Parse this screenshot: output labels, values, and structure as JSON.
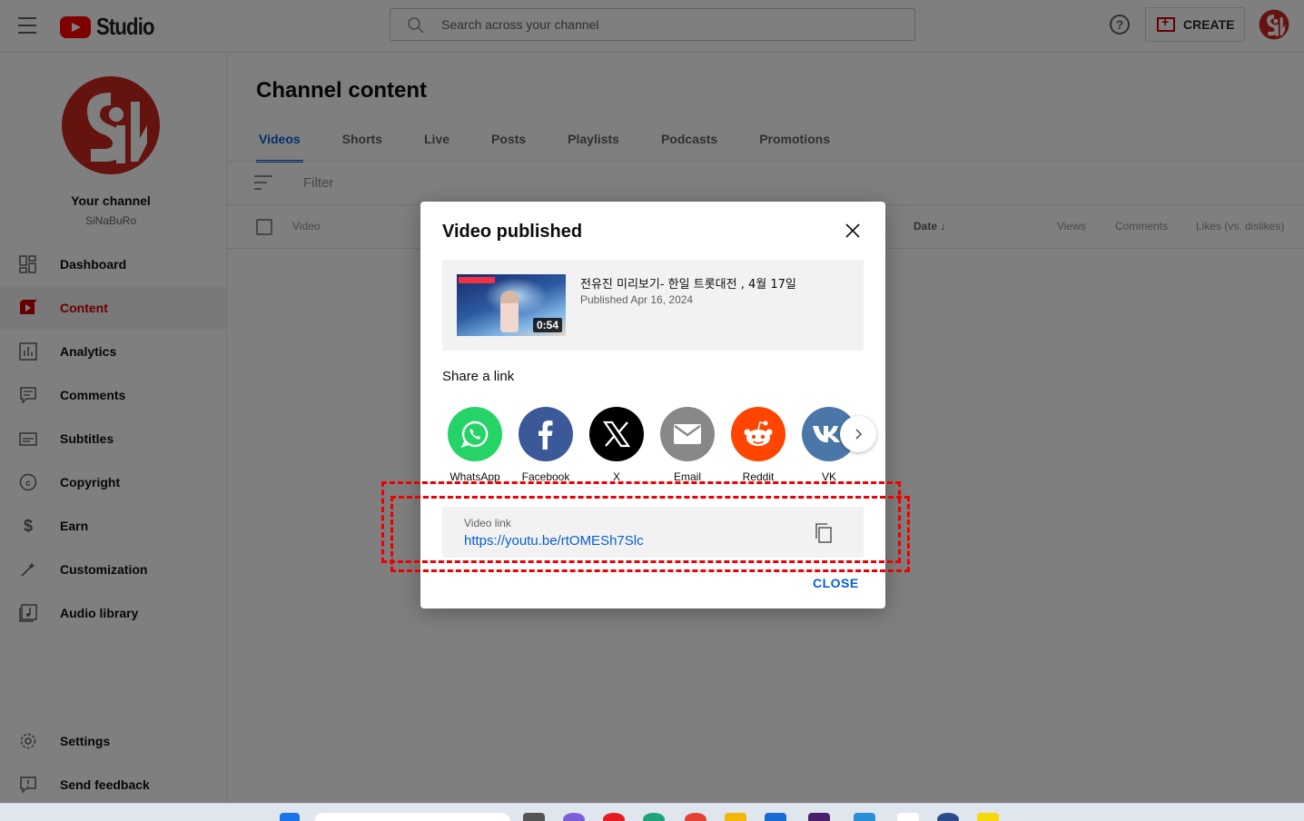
{
  "header": {
    "logo_text": "Studio",
    "search_placeholder": "Search across your channel",
    "help_symbol": "?",
    "create_label": "CREATE"
  },
  "channel": {
    "title": "Your channel",
    "handle": "SiNaBuRo"
  },
  "sidebar": {
    "items": [
      {
        "label": "Dashboard",
        "icon": "dashboard-icon"
      },
      {
        "label": "Content",
        "icon": "content-icon",
        "active": true
      },
      {
        "label": "Analytics",
        "icon": "analytics-icon"
      },
      {
        "label": "Comments",
        "icon": "comments-icon"
      },
      {
        "label": "Subtitles",
        "icon": "subtitles-icon"
      },
      {
        "label": "Copyright",
        "icon": "copyright-icon"
      },
      {
        "label": "Earn",
        "icon": "dollar-icon"
      },
      {
        "label": "Customization",
        "icon": "magic-wand-icon"
      },
      {
        "label": "Audio library",
        "icon": "audio-library-icon"
      }
    ],
    "bottom_items": [
      {
        "label": "Settings",
        "icon": "gear-icon"
      },
      {
        "label": "Send feedback",
        "icon": "feedback-icon"
      }
    ]
  },
  "main": {
    "title": "Channel content",
    "tabs": [
      {
        "label": "Videos",
        "active": true
      },
      {
        "label": "Shorts"
      },
      {
        "label": "Live"
      },
      {
        "label": "Posts"
      },
      {
        "label": "Playlists"
      },
      {
        "label": "Podcasts"
      },
      {
        "label": "Promotions"
      }
    ],
    "filter_placeholder": "Filter",
    "columns": {
      "video": "Video",
      "date": "Date",
      "views": "Views",
      "comments": "Comments",
      "likes": "Likes (vs. dislikes)"
    }
  },
  "dialog": {
    "title": "Video published",
    "video": {
      "title": "전유진 미리보기- 한일 트롯대전 , 4월 17일",
      "published": "Published Apr 16, 2024",
      "duration": "0:54"
    },
    "share_label": "Share a link",
    "share_targets": [
      {
        "label": "WhatsApp",
        "color": "#25d366",
        "icon": "whatsapp-icon"
      },
      {
        "label": "Facebook",
        "color": "#3b5998",
        "icon": "facebook-icon"
      },
      {
        "label": "X",
        "color": "#000000",
        "icon": "x-icon"
      },
      {
        "label": "Email",
        "color": "#888888",
        "icon": "email-icon"
      },
      {
        "label": "Reddit",
        "color": "#ff4500",
        "icon": "reddit-icon"
      },
      {
        "label": "VK",
        "color": "#4a76a8",
        "icon": "vk-icon"
      }
    ],
    "link_label": "Video link",
    "link_url": "https://youtu.be/rtOMESh7Slc",
    "close_label": "CLOSE"
  },
  "colors": {
    "accent_blue": "#065fd4",
    "brand_red": "#cc0000",
    "annotation_red": "#ee0000"
  }
}
